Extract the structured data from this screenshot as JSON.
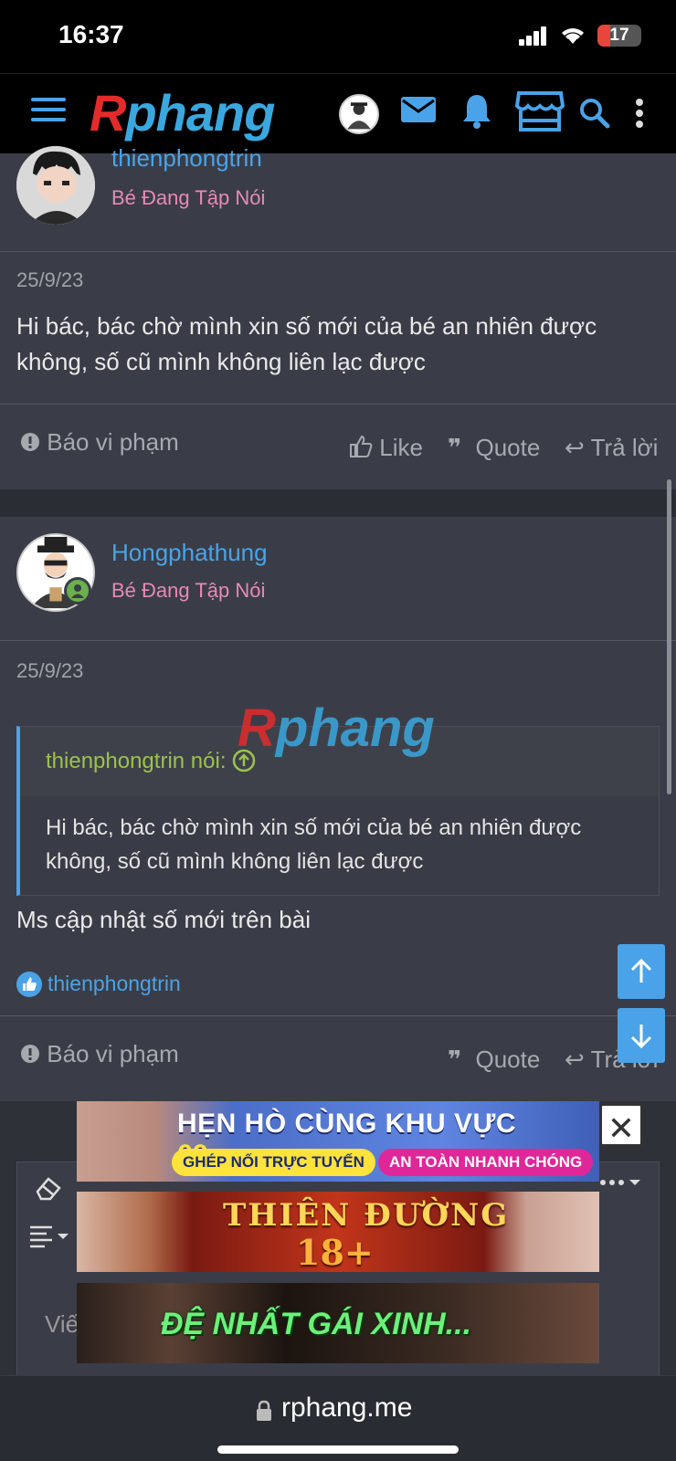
{
  "status": {
    "time": "16:37",
    "battery": "17"
  },
  "appbar": {
    "logo_r": "R",
    "logo_rest": "phang"
  },
  "post1": {
    "username": "thienphongtrin",
    "usertitle": "Bé Đang Tập Nói",
    "date": "25/9/23",
    "content": "Hi bác, bác chờ mình xin số mới của bé an nhiên được không, số cũ mình không liên lạc được",
    "report": "Báo vi phạm",
    "like": "Like",
    "quote": "Quote",
    "reply": "Trả lời"
  },
  "post2": {
    "username": "Hongphathung",
    "usertitle": "Bé Đang Tập Nói",
    "date": "25/9/23",
    "quote_author": "thienphongtrin nói:",
    "quote_text": "Hi bác, bác chờ mình xin số mới của bé an nhiên được không, số cũ mình không liên lạc được",
    "content": "Ms cập nhật số mới trên bài",
    "liked_by": "thienphongtrin",
    "report": "Báo vi phạm",
    "quote": "Quote",
    "reply": "Trả lời"
  },
  "watermark": {
    "r": "R",
    "rest": "phang"
  },
  "editor": {
    "placeholder": "Viế"
  },
  "ads": {
    "ad1_title_a": "HẸN HÒ CÙNG KHU VỰC ",
    "ad1_title_b": "69xxoo.cc",
    "ad1_pill1": "GHÉP NỐI TRỰC TUYẾN",
    "ad1_pill2": "AN TOÀN NHANH CHÓNG",
    "ad2_title": "THIÊN ĐƯỜNG",
    "ad2_sub": "18+",
    "ad3_title": "ĐỆ NHẤT GÁI XINH...",
    "close": "✕"
  },
  "urlbar": {
    "url": "rphang.me"
  },
  "colors": {
    "accent": "#4aa3e8",
    "usertitle": "#e889b6",
    "quote_author": "#9cc24d",
    "online": "#6ab04c"
  }
}
